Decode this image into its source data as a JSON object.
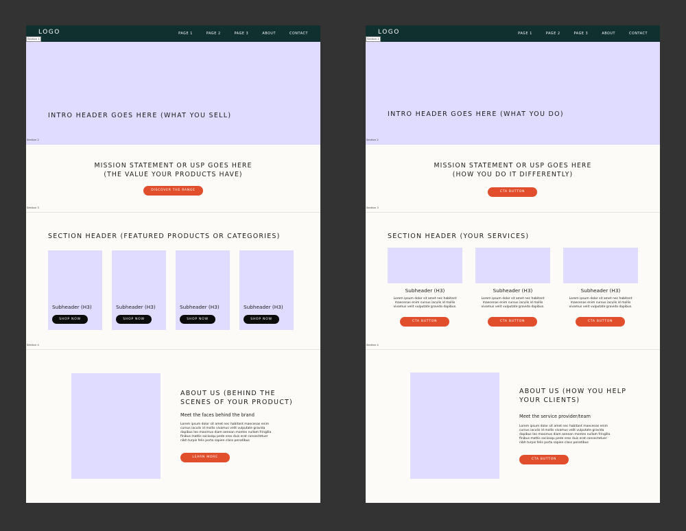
{
  "colors": {
    "background": "#333333",
    "nav": "#10302f",
    "placeholder": "#e0dcff",
    "accent": "#e04e2c",
    "page": "#fcfbf7",
    "black_button": "#0b0b0b"
  },
  "left": {
    "logo": "LOGO",
    "nav": [
      "PAGE 1",
      "PAGE 2",
      "PAGE 3",
      "ABOUT",
      "CONTACT"
    ],
    "section_labels": [
      "Section 1",
      "Section 2",
      "Section 3",
      "Section 4"
    ],
    "hero_title": "INTRO HEADER GOES HERE (WHAT YOU SELL)",
    "mission_line1": "MISSION STATEMENT OR USP GOES HERE",
    "mission_line2": "(THE VALUE YOUR PRODUCTS HAVE)",
    "mission_button": "DISCOVER THE RANGE",
    "section_header": "SECTION HEADER (FEATURED PRODUCTS OR CATEGORIES)",
    "products": [
      {
        "subheader": "Subheader (H3)",
        "button": "SHOP NOW"
      },
      {
        "subheader": "Subheader (H3)",
        "button": "SHOP NOW"
      },
      {
        "subheader": "Subheader (H3)",
        "button": "SHOP NOW"
      },
      {
        "subheader": "Subheader (H3)",
        "button": "SHOP NOW"
      }
    ],
    "about_title_line1": "ABOUT US (BEHIND THE",
    "about_title_line2": "SCENES OF YOUR PRODUCT)",
    "about_sub": "Meet the faces behind the brand",
    "about_body": [
      "Lorem ipsum dolor sit amet nec habitant maecenas enim",
      "cursus iaculis id mollis vivamus velit vulputate gravida",
      "dapibus leo maximus diam aenean montes nullam fringilla",
      "finibus mattis sociosqu pede eros duis erat consectetuer",
      "nibh turpis felis porta sapien class penatibus"
    ],
    "about_button": "LEARN MORE"
  },
  "right": {
    "logo": "LOGO",
    "nav": [
      "PAGE 1",
      "PAGE 2",
      "PAGE 3",
      "ABOUT",
      "CONTACT"
    ],
    "section_labels": [
      "Section 1",
      "Section 2",
      "Section 3",
      "Section 4"
    ],
    "hero_title": "INTRO HEADER GOES HERE (WHAT YOU DO)",
    "mission_line1": "MISSION STATEMENT OR USP GOES HERE",
    "mission_line2": "(HOW YOU DO IT DIFFERENTLY)",
    "mission_button": "CTA BUTTON",
    "section_header": "SECTION HEADER (YOUR SERVICES)",
    "services": [
      {
        "subheader": "Subheader (H3)",
        "body": [
          "Lorem ipsum dolor sit amet nec habitant",
          "maecenas enim cursus iaculis id mollis",
          "vivamus velit vulputate gravida dapibus."
        ],
        "button": "CTA BUTTON"
      },
      {
        "subheader": "Subheader (H3)",
        "body": [
          "Lorem ipsum dolor sit amet nec habitant",
          "maecenas enim cursus iaculis id mollis",
          "vivamus velit vulputate gravida dapibus."
        ],
        "button": "CTA BUTTON"
      },
      {
        "subheader": "Subheader (H3)",
        "body": [
          "Lorem ipsum dolor sit amet nec habitant",
          "maecenas enim cursus iaculis id mollis",
          "vivamus velit vulputate gravida dapibus."
        ],
        "button": "CTA BUTTON"
      }
    ],
    "about_title_line1": "ABOUT US (HOW YOU HELP",
    "about_title_line2": "YOUR CLIENTS)",
    "about_sub": "Meet the service provider/team",
    "about_body": [
      "Lorem ipsum dolor sit amet nec habitant maecenas enim",
      "cursus iaculis id mollis vivamus velit vulputate gravida",
      "dapibus leo maximus diam aenean montes nullam fringilla",
      "finibus mattis sociosqu pede eros duis erat consectetuer",
      "nibh turpis felis porta sapien class penatibus"
    ],
    "about_button": "CTA BUTTON"
  }
}
